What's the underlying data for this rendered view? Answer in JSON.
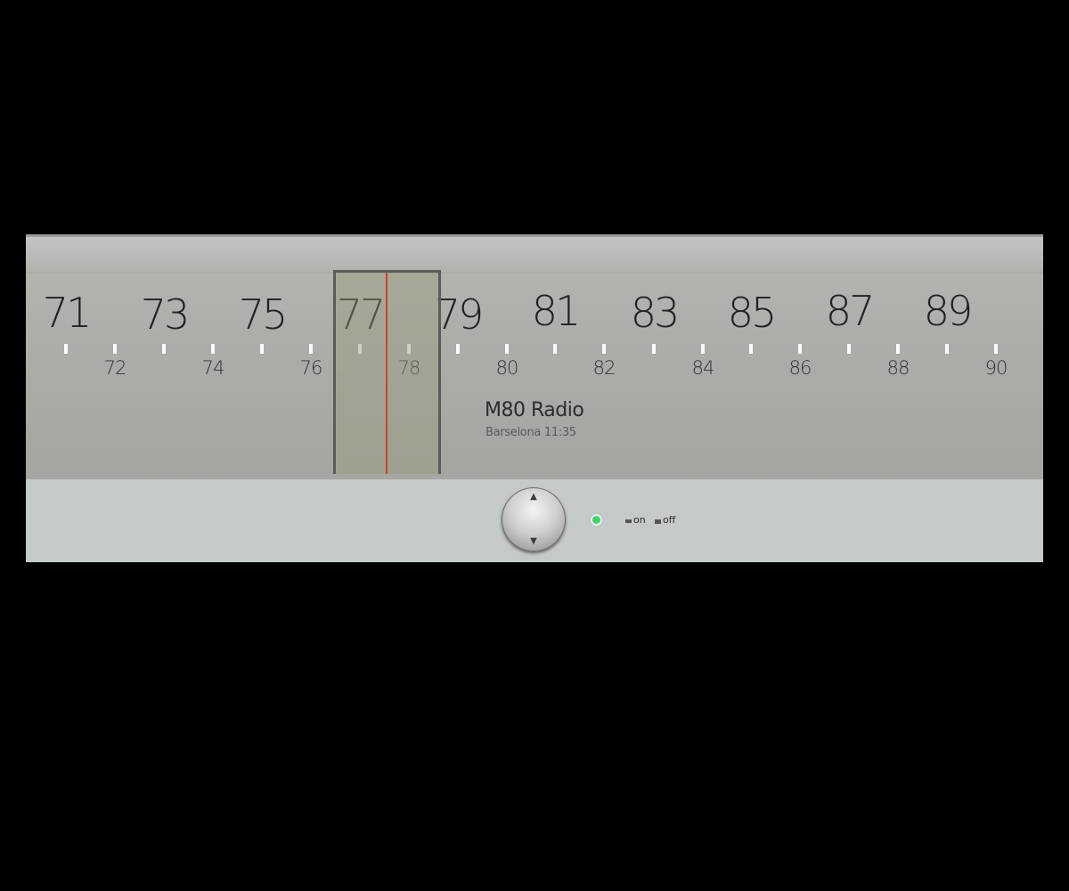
{
  "colors": {
    "needle": "#d0402a",
    "led_on": "#3fd46a"
  },
  "dial": {
    "major_numbers": [
      "71",
      "73",
      "75",
      "77",
      "79",
      "81",
      "83",
      "85",
      "87",
      "89"
    ],
    "minor_numbers": [
      "72",
      "74",
      "76",
      "78",
      "80",
      "82",
      "84",
      "86",
      "88",
      "90"
    ],
    "tuned_frequency": 77.6
  },
  "station": {
    "name": "M80 Radio",
    "subtitle": "Barselona 11:35"
  },
  "controls": {
    "knob_up_icon": "▲",
    "knob_down_icon": "▼",
    "power_indicator": "led-green",
    "switch_on_label": "on",
    "switch_off_label": "off"
  }
}
